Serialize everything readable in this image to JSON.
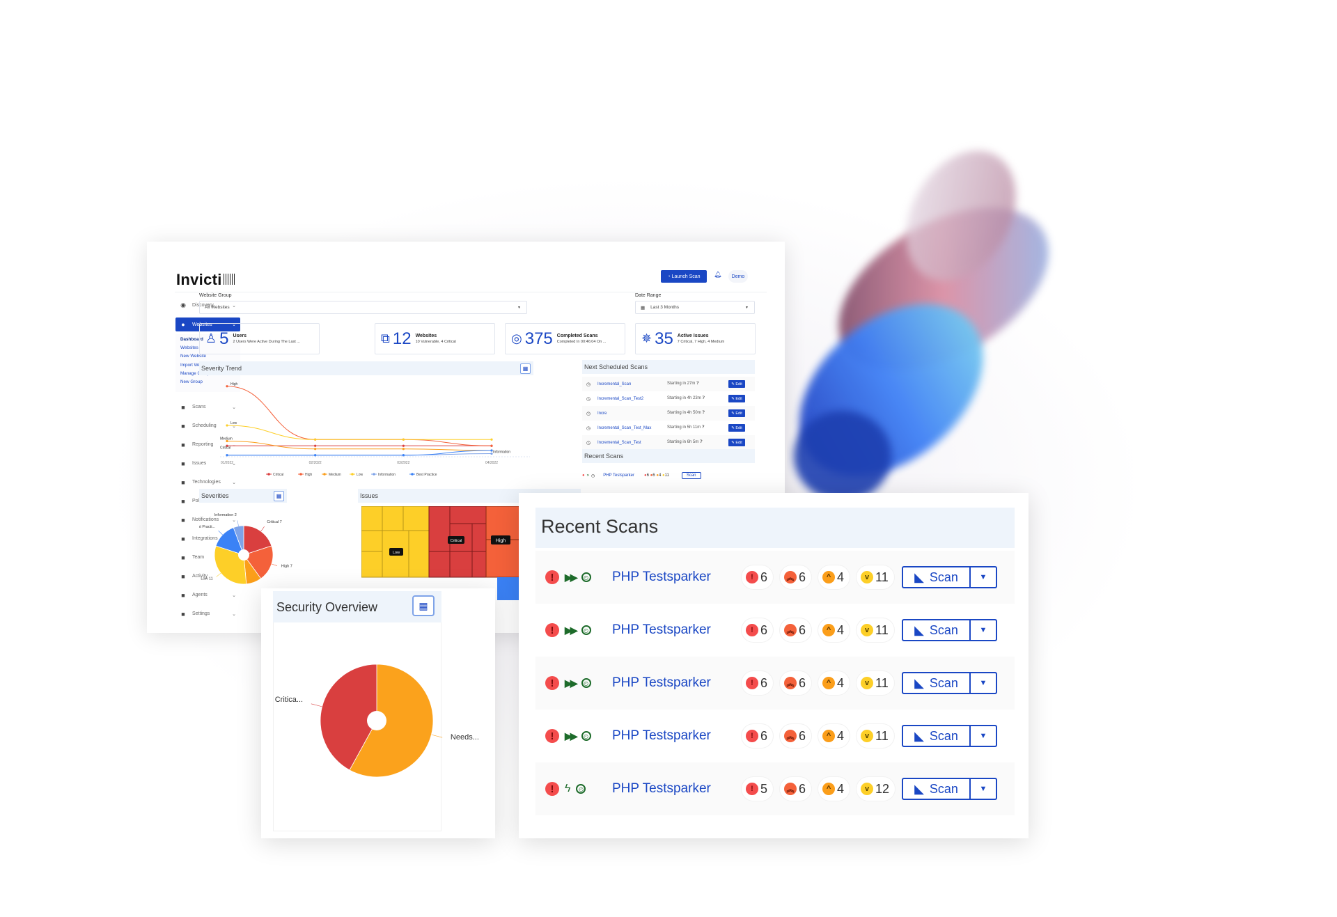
{
  "app": {
    "logo": "Invicti",
    "launch_scan": "Launch Scan",
    "user": "Demo"
  },
  "sidebar": {
    "discovery": "Discovery",
    "websites": "Websites",
    "websites_sub": [
      "Dashboard",
      "Websites",
      "New Website",
      "Import Websites",
      "Manage Groups",
      "New Group"
    ],
    "items": [
      {
        "label": "Scans",
        "icon": "shark-fin-icon"
      },
      {
        "label": "Scheduling",
        "icon": "schedule-icon"
      },
      {
        "label": "Reporting",
        "icon": "bar-chart-icon"
      },
      {
        "label": "Issues",
        "icon": "bug-icon"
      },
      {
        "label": "Technologies",
        "icon": "chip-icon"
      },
      {
        "label": "Policies",
        "icon": "clipboard-icon"
      },
      {
        "label": "Notifications",
        "icon": "bell-icon"
      },
      {
        "label": "Integrations",
        "icon": "puzzle-icon"
      },
      {
        "label": "Team",
        "icon": "team-icon"
      },
      {
        "label": "Activity",
        "icon": "book-icon"
      },
      {
        "label": "Agents",
        "icon": "gear-cluster-icon"
      },
      {
        "label": "Settings",
        "icon": "gear-icon"
      }
    ]
  },
  "filters": {
    "website_group_label": "Website Group",
    "website_group_value": "All Websites",
    "date_range_label": "Date Range",
    "date_range_value": "Last 3 Months"
  },
  "stats": [
    {
      "num": "5",
      "title": "Users",
      "desc": "2 Users Were Active During The Last ..."
    },
    {
      "num": "12",
      "title": "Websites",
      "desc": "10 Vulnerable, 4 Critical"
    },
    {
      "num": "375",
      "title": "Completed Scans",
      "desc": "Completed In 00:46:04 On ..."
    },
    {
      "num": "35",
      "title": "Active Issues",
      "desc": "7 Critical, 7 High, 4 Medium"
    }
  ],
  "severity_trend": {
    "title": "Severity Trend"
  },
  "next_scheduled": {
    "title": "Next Scheduled Scans",
    "edit": "Edit",
    "rows": [
      {
        "name": "Incremental_Scan",
        "start": "Starting in 27m"
      },
      {
        "name": "Incremental_Scan_Test2",
        "start": "Starting in 4h 23m"
      },
      {
        "name": "Incre",
        "start": "Starting in 4h 50m"
      },
      {
        "name": "Incremental_Scan_Test_Max",
        "start": "Starting in 5h 11m"
      },
      {
        "name": "Incremental_Scan_Test",
        "start": "Starting in 6h 5m"
      }
    ]
  },
  "severities": {
    "title": "Severities"
  },
  "issues": {
    "title": "Issues",
    "labels": [
      "Low",
      "Critical",
      "High"
    ]
  },
  "recent_scans": {
    "title": "Recent Scans",
    "scan_label": "Scan",
    "rows": [
      {
        "name": "PHP Testsparker",
        "type": "fast-forward-icon",
        "critical": "6",
        "high": "6",
        "medium": "4",
        "low": "11"
      },
      {
        "name": "PHP Testsparker",
        "type": "fast-forward-icon",
        "critical": "6",
        "high": "6",
        "medium": "4",
        "low": "11"
      },
      {
        "name": "PHP Testsparker",
        "type": "fast-forward-icon",
        "critical": "6",
        "high": "6",
        "medium": "4",
        "low": "11"
      },
      {
        "name": "PHP Testsparker",
        "type": "fast-forward-icon",
        "critical": "6",
        "high": "6",
        "medium": "4",
        "low": "11"
      },
      {
        "name": "PHP Testsparker",
        "type": "lightning-icon",
        "critical": "5",
        "high": "6",
        "medium": "4",
        "low": "12"
      }
    ]
  },
  "security_overview": {
    "title": "Security Overview"
  },
  "colors": {
    "brand": "#1a47c4",
    "critical": "#d93f3f",
    "high": "#f4613a",
    "medium": "#fb9e1a",
    "low": "#fdcf28",
    "information": "#7ea3e8",
    "best_practice": "#3b82f6"
  },
  "chart_data": [
    {
      "type": "line",
      "title": "Severity Trend",
      "categories": [
        "01/2022",
        "02/2022",
        "03/2022",
        "04/2022"
      ],
      "series": [
        {
          "name": "Critical",
          "values": [
            7,
            7,
            7,
            7
          ],
          "color": "#d93f3f"
        },
        {
          "name": "High",
          "values": [
            45,
            11,
            11,
            7
          ],
          "color": "#f4613a"
        },
        {
          "name": "Medium",
          "values": [
            10,
            5,
            5,
            4
          ],
          "color": "#fb9e1a"
        },
        {
          "name": "Low",
          "values": [
            20,
            11,
            11,
            11
          ],
          "color": "#fdcf28"
        },
        {
          "name": "Information",
          "values": [
            1,
            1,
            1,
            2
          ],
          "color": "#7ea3e8"
        },
        {
          "name": "Best Practice",
          "values": [
            1,
            1,
            1,
            4
          ],
          "color": "#3b82f6"
        }
      ],
      "point_labels": [
        "High",
        "Low",
        "Medium",
        "Critical",
        "Information"
      ],
      "legend": "bottom"
    },
    {
      "type": "pie",
      "title": "Severities",
      "slices": [
        {
          "label": "Critical 7",
          "value": 7,
          "color": "#d93f3f"
        },
        {
          "label": "High 7",
          "value": 7,
          "color": "#f4613a"
        },
        {
          "label": "",
          "value": 3,
          "color": "#fb9e1a"
        },
        {
          "label": "Low 11",
          "value": 11,
          "color": "#fdcf28"
        },
        {
          "label": "Best Practi...",
          "value": 5,
          "color": "#3b82f6"
        },
        {
          "label": "Information 2",
          "value": 2,
          "color": "#7ea3e8"
        }
      ]
    },
    {
      "type": "pie",
      "title": "Security Overview",
      "slices": [
        {
          "label": "Needs...",
          "value": 58,
          "color": "#fba21c"
        },
        {
          "label": "Critica...",
          "value": 42,
          "color": "#d93f3f"
        }
      ]
    }
  ]
}
